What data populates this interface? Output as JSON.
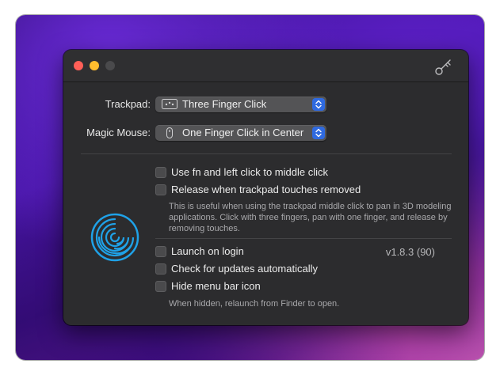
{
  "window": {
    "traffic_lights": [
      "close",
      "minimize",
      "zoom"
    ],
    "header_icon": "key-icon"
  },
  "trackpad": {
    "label": "Trackpad:",
    "selected": "Three Finger Click",
    "icon": "trackpad-dots-icon"
  },
  "mouse": {
    "label": "Magic Mouse:",
    "selected": "One Finger Click in Center",
    "icon": "mouse-icon"
  },
  "options": [
    {
      "label": "Use fn and left click to middle click",
      "checked": false
    },
    {
      "label": "Release when trackpad touches removed",
      "checked": false
    }
  ],
  "release_note": "This is useful when using the trackpad middle click to pan in 3D modeling applications. Click with three fingers, pan with one finger, and release by removing touches.",
  "app": {
    "logo": "middle-logo-icon",
    "version": "v1.8.3 (90)"
  },
  "settings": [
    {
      "label": "Launch on login",
      "checked": false
    },
    {
      "label": "Check for updates automatically",
      "checked": false
    },
    {
      "label": "Hide menu bar icon",
      "checked": false
    }
  ],
  "hide_note": "When hidden, relaunch from Finder to open.",
  "colors": {
    "accent": "#2f6ae0",
    "logo": "#1fa2e8",
    "window_bg": "#2c2c2e"
  }
}
